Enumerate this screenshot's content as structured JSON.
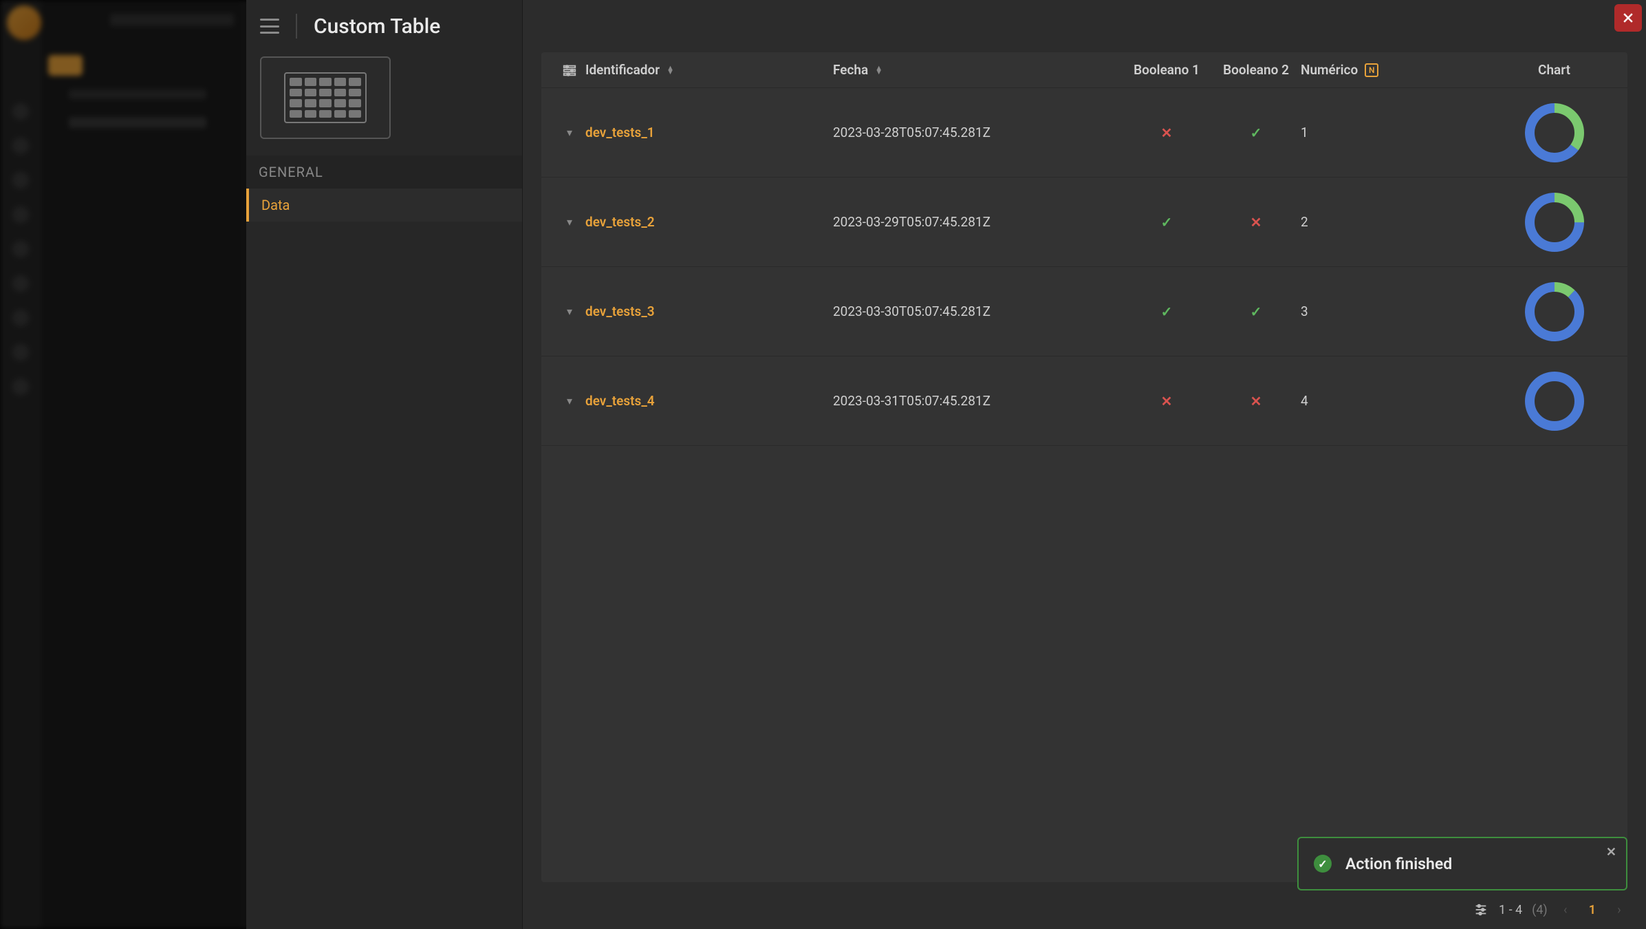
{
  "panel": {
    "title": "Custom Table",
    "side": {
      "general_label": "GENERAL",
      "active_label": "Data"
    }
  },
  "table": {
    "headers": {
      "identificador": "Identificador",
      "fecha": "Fecha",
      "booleano1": "Booleano 1",
      "booleano2": "Booleano 2",
      "numerico": "Numérico",
      "chart": "Chart"
    },
    "rows": [
      {
        "id": "dev_tests_1",
        "fecha": "2023-03-28T05:07:45.281Z",
        "b1": false,
        "b2": true,
        "num": "1",
        "chart_green_pct": 35
      },
      {
        "id": "dev_tests_2",
        "fecha": "2023-03-29T05:07:45.281Z",
        "b1": true,
        "b2": false,
        "num": "2",
        "chart_green_pct": 25
      },
      {
        "id": "dev_tests_3",
        "fecha": "2023-03-30T05:07:45.281Z",
        "b1": true,
        "b2": true,
        "num": "3",
        "chart_green_pct": 12
      },
      {
        "id": "dev_tests_4",
        "fecha": "2023-03-31T05:07:45.281Z",
        "b1": false,
        "b2": false,
        "num": "4",
        "chart_green_pct": 0
      }
    ]
  },
  "toast": {
    "message": "Action finished"
  },
  "footer": {
    "range": "1 - 4",
    "total": "(4)",
    "page": "1"
  },
  "colors": {
    "accent": "#e8a23a",
    "chart_blue": "#4a7ad6",
    "chart_green": "#7bc96f",
    "true": "#5fb85f",
    "false": "#d9534f"
  }
}
